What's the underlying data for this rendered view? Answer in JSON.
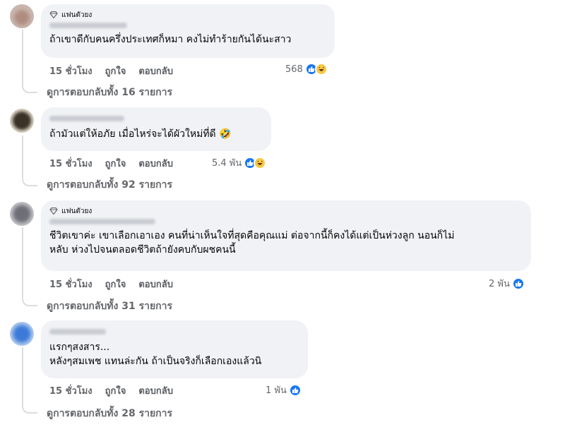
{
  "comments": [
    {
      "badge": "แฟนตัวยง",
      "lines": [
        "ถ้าเขาดีกับคนครึ่งประเทศก็หมา คงไม่ทำร้ายกันได้นะสาว"
      ],
      "time": "15 ชั่วโมง",
      "like_label": "ถูกใจ",
      "reply_label": "ตอบกลับ",
      "reaction_count": "568",
      "reactions": [
        "like-icon",
        "haha-icon"
      ],
      "view_replies": "ดูการตอบกลับทั้ง 16 รายการ"
    },
    {
      "badge": "",
      "lines": [
        "ถ้ามัวแต่ให้อภัย เมื่อไหร่จะได้ผัวใหม่ที่ดี 🤣"
      ],
      "time": "15 ชั่วโมง",
      "like_label": "ถูกใจ",
      "reply_label": "ตอบกลับ",
      "reaction_count": "5.4 พัน",
      "reactions": [
        "like-icon",
        "haha-icon"
      ],
      "view_replies": "ดูการตอบกลับทั้ง 92 รายการ"
    },
    {
      "badge": "แฟนตัวยง",
      "lines": [
        "ชีวิตเขาค่ะ เขาเลือกเอาเอง คนที่น่าเห็นใจที่สุดคือคุณแม่ ต่อจากนี้ก็คงได้แต่เป็นห่วงลูก นอนก็ไม่",
        "หลับ ห่วงไปจนตลอดชีวิตถ้ายังคบกับผชคนนี้"
      ],
      "time": "15 ชั่วโมง",
      "like_label": "ถูกใจ",
      "reply_label": "ตอบกลับ",
      "reaction_count": "2 พัน",
      "reactions": [
        "like-icon"
      ],
      "view_replies": "ดูการตอบกลับทั้ง 31 รายการ"
    },
    {
      "badge": "",
      "lines": [
        "แรกๆสงสาร...",
        "หลังๆสมเพช แทนล่ะกัน ถ้าเป็นจริงก็เลือกเองแล้วนิ"
      ],
      "time": "15 ชั่วโมง",
      "like_label": "ถูกใจ",
      "reply_label": "ตอบกลับ",
      "reaction_count": "1 พัน",
      "reactions": [
        "like-icon"
      ],
      "view_replies": "ดูการตอบกลับทั้ง 28 รายการ"
    }
  ],
  "colors": {
    "like": "#1877f2",
    "haha": "#f7c844",
    "bubble": "#f0f2f5",
    "muted": "#65676b"
  }
}
